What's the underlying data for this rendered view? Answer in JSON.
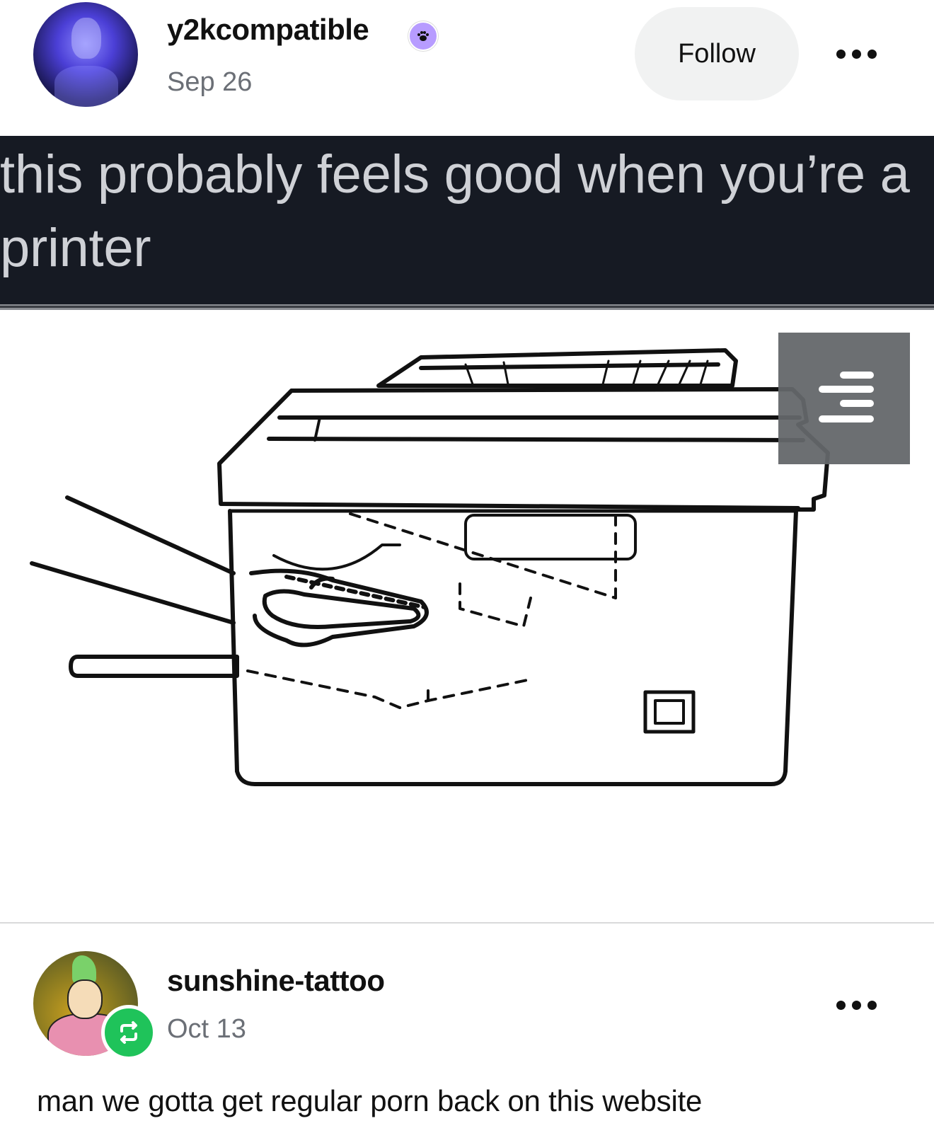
{
  "post": {
    "author": "y2kcompatible",
    "date": "Sep 26",
    "follow_label": "Follow",
    "author_badge_icon": "paw-badge-icon",
    "caption": "this probably feels good when you’re a printer",
    "image_alt_icons": [
      "printer-illustration",
      "hand-illustration"
    ],
    "gallery_icon": "gallery-menu-icon"
  },
  "reblog": {
    "author": "sunshine-tattoo",
    "date": "Oct 13",
    "badge_icon": "reblog-icon",
    "comment": "man we gotta get regular porn back on this website"
  },
  "colors": {
    "caption_bg": "#161a23",
    "caption_text": "#cfd1d6",
    "follow_bg": "#f1f2f2",
    "reblog_green": "#1fc35a",
    "date_gray": "#6b6f76"
  }
}
